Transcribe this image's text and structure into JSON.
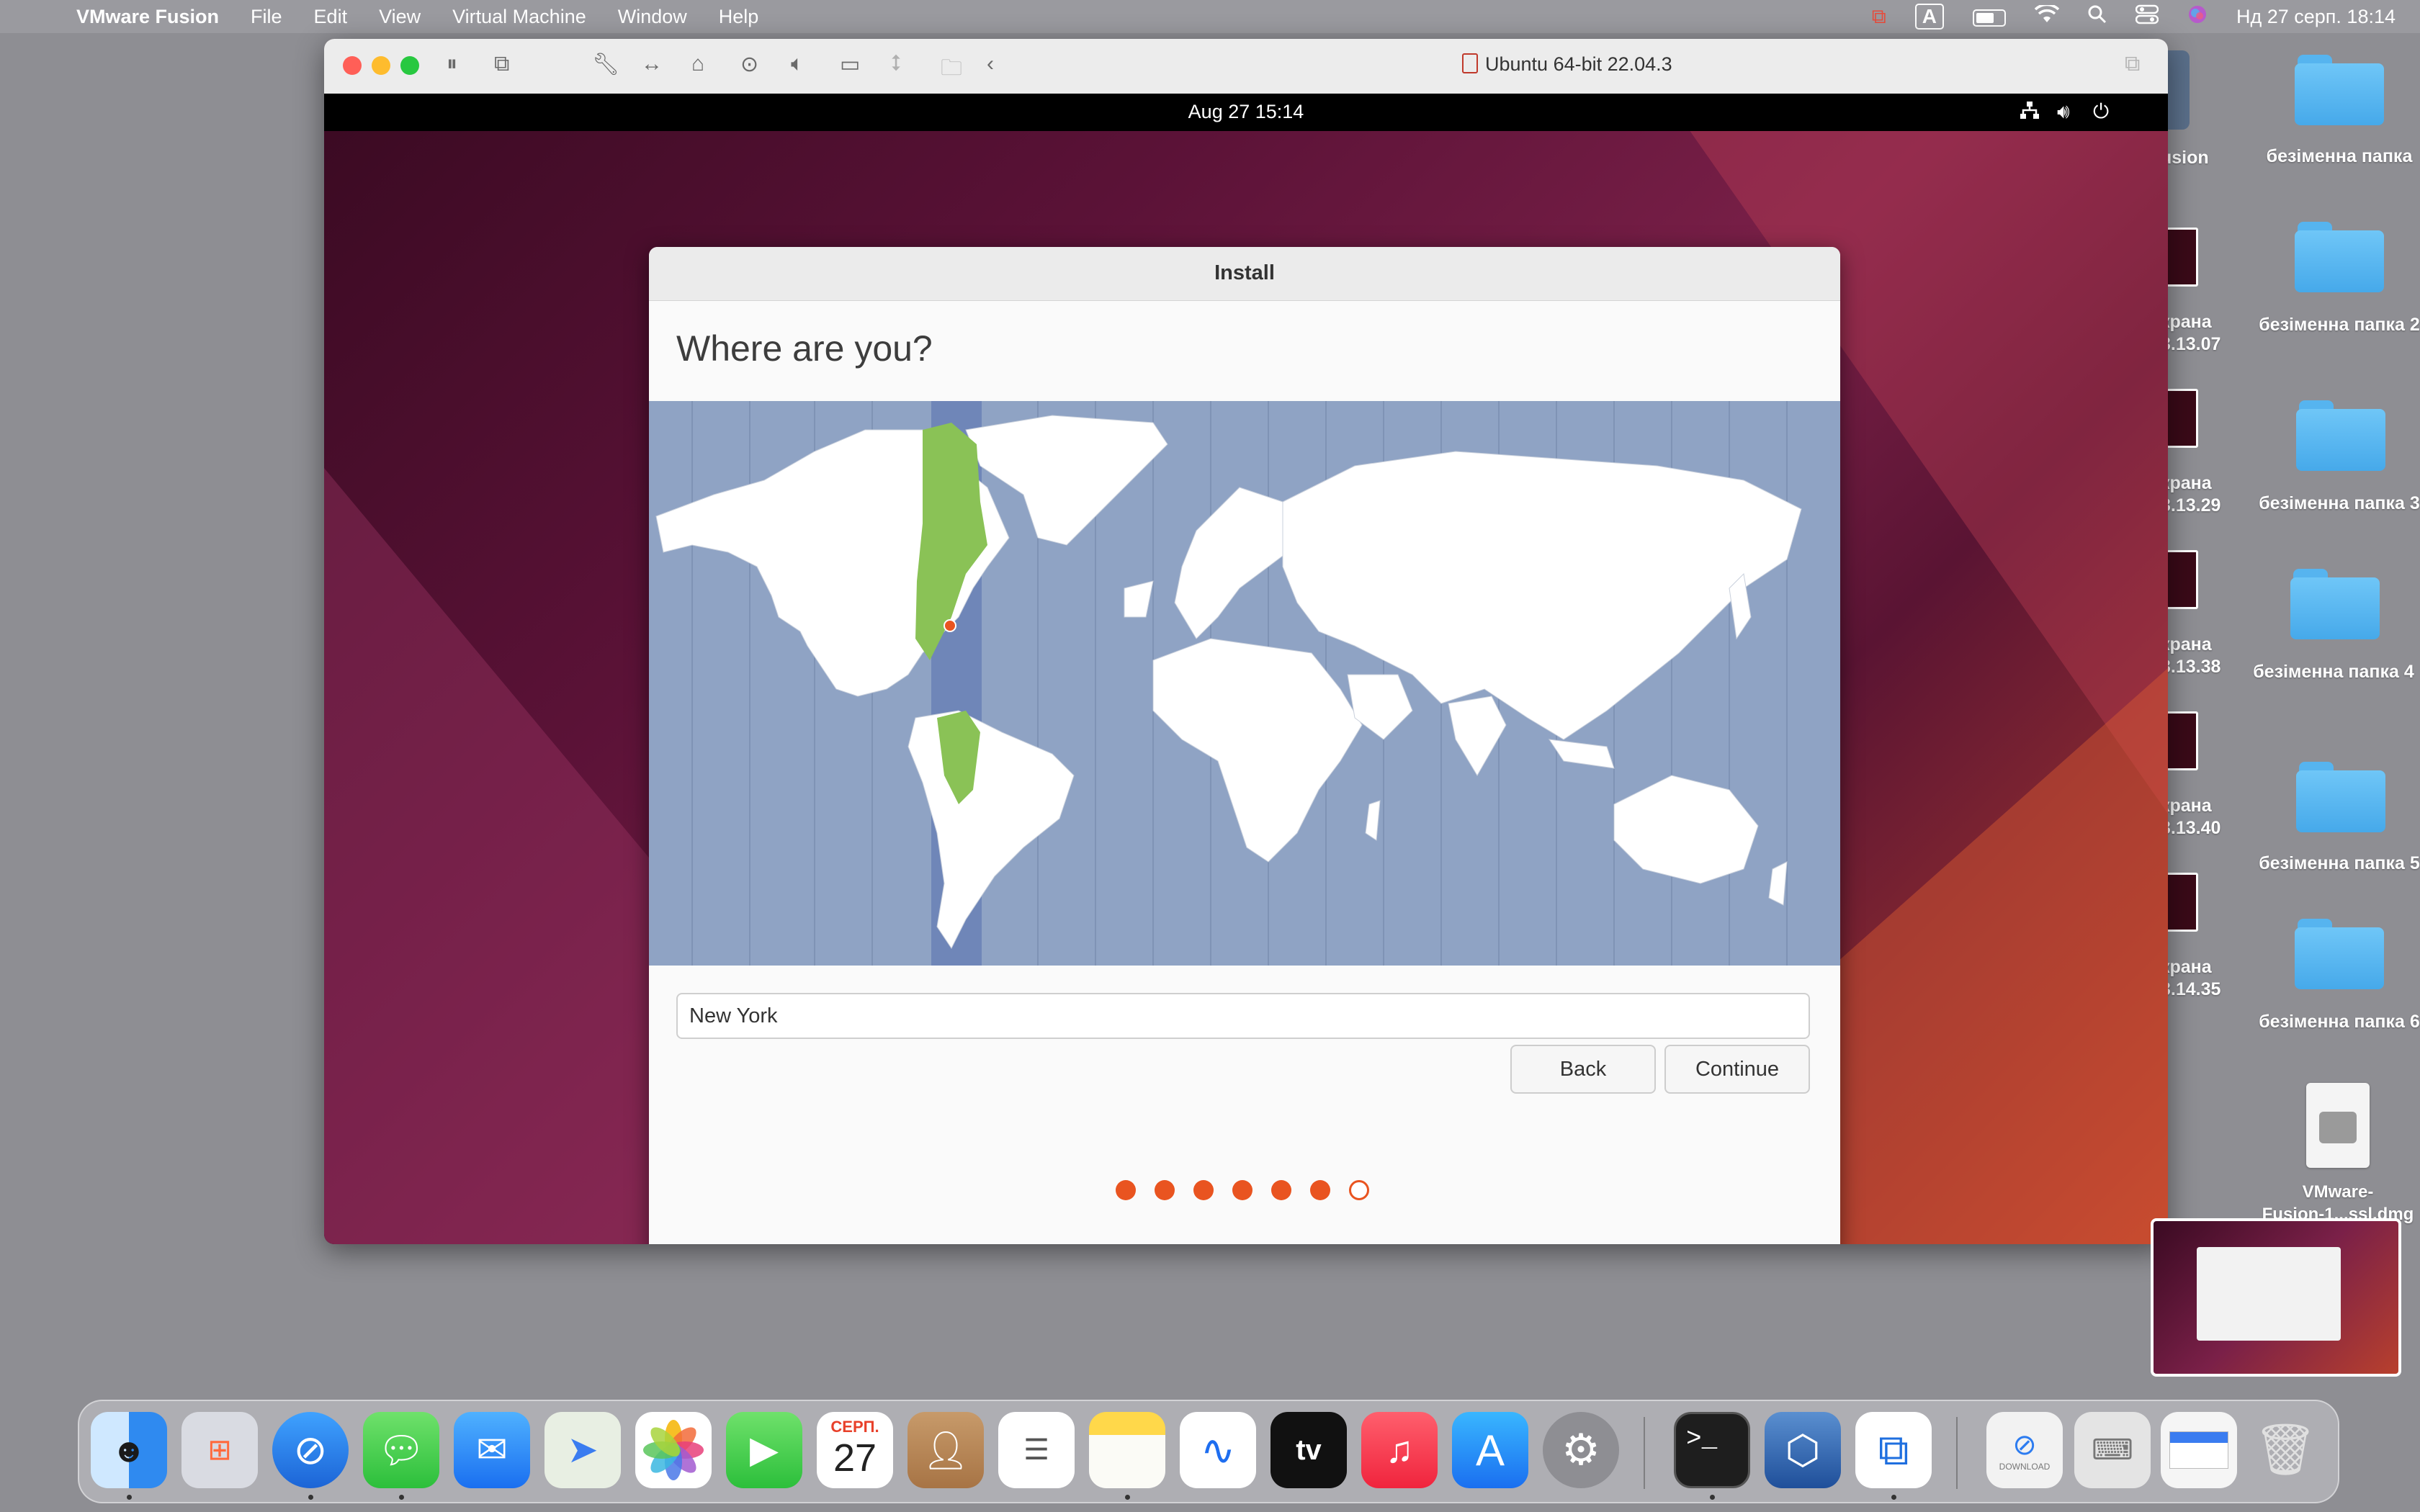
{
  "menubar": {
    "apple": "",
    "app_name": "VMware Fusion",
    "items": [
      "File",
      "Edit",
      "View",
      "Virtual Machine",
      "Window",
      "Help"
    ],
    "input_source": "A",
    "clock": "Нд 27 серп.  18:14"
  },
  "desktop": {
    "folders": [
      {
        "label": "безіменна папка"
      },
      {
        "label": "безіменна папка 2"
      },
      {
        "label": "безіменна папка 3"
      },
      {
        "label": "безіменна папка 4"
      },
      {
        "label": "безіменна папка 5"
      },
      {
        "label": "безіменна папка 6"
      }
    ],
    "partial_fusion_label": "usion",
    "screenshots": [
      {
        "line1": "крана",
        "line2": "3.13.07"
      },
      {
        "line1": "крана",
        "line2": "3.13.29"
      },
      {
        "line1": "крана",
        "line2": "3.13.38"
      },
      {
        "line1": "крана",
        "line2": "3.13.40"
      },
      {
        "line1": "крана",
        "line2": "3.14.35"
      }
    ],
    "dmg_label_line1": "VMware-",
    "dmg_label_line2": "Fusion-1...ssl.dmg"
  },
  "vm_window": {
    "title": "Ubuntu 64-bit 22.04.3"
  },
  "guest": {
    "clock": "Aug 27  15:14"
  },
  "installer": {
    "window_title": "Install",
    "heading": "Where are you?",
    "timezone_value": "New York",
    "back_label": "Back",
    "continue_label": "Continue",
    "progress": {
      "completed": 6,
      "total": 7
    },
    "accent_color": "#e95420"
  },
  "dock": {
    "calendar_month": "СЕРП.",
    "calendar_day": "27",
    "tv_label": "tv",
    "terminal_prompt": ">_",
    "download_label": "DOWNLOAD"
  }
}
